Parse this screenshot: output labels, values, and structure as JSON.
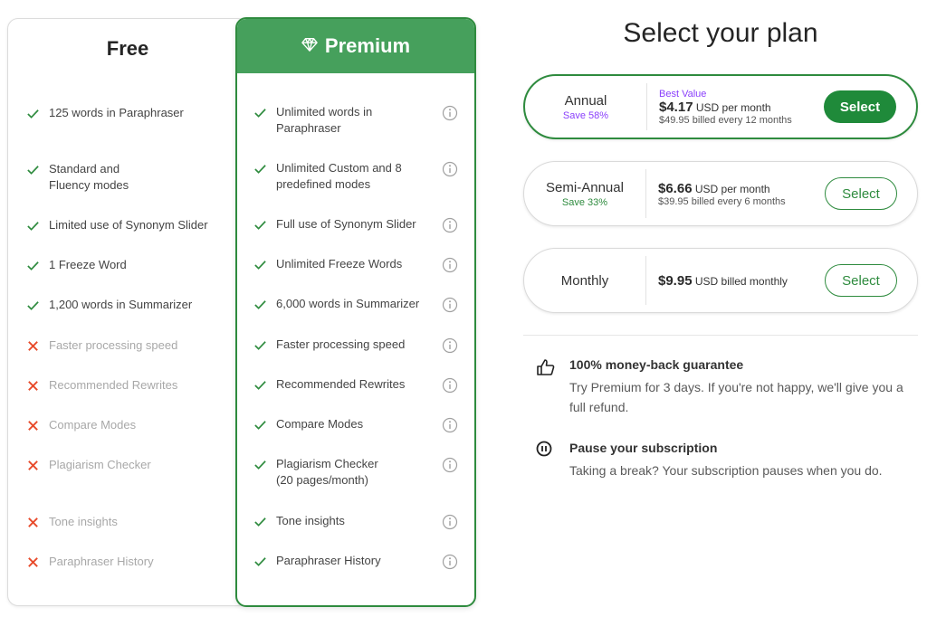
{
  "colors": {
    "brand_green": "#2e8b3e",
    "premium_header": "#46a05c",
    "check_green": "#2e8b3e",
    "cross_red": "#e84a2a",
    "accent_purple": "#8a3ffc",
    "save_green": "#2e8b3e"
  },
  "free_plan": {
    "title": "Free",
    "features": [
      {
        "text": "125 words in Paraphraser",
        "included": true
      },
      {
        "text": "Standard and Fluency modes",
        "included": true
      },
      {
        "text": "Limited use of Synonym Slider",
        "included": true
      },
      {
        "text": "1 Freeze Word",
        "included": true
      },
      {
        "text": "1,200 words in Summarizer",
        "included": true
      },
      {
        "text": "Faster processing speed",
        "included": false
      },
      {
        "text": "Recommended Rewrites",
        "included": false
      },
      {
        "text": "Compare Modes",
        "included": false
      },
      {
        "text": "Plagiarism Checker",
        "included": false
      },
      {
        "text": "Tone insights",
        "included": false
      },
      {
        "text": "Paraphraser History",
        "included": false
      }
    ]
  },
  "premium_plan": {
    "title": "Premium",
    "icon": "diamond-icon",
    "features": [
      {
        "text": "Unlimited words in Paraphraser",
        "included": true
      },
      {
        "text": "Unlimited Custom and 8 predefined modes",
        "included": true
      },
      {
        "text": "Full use of Synonym Slider",
        "included": true
      },
      {
        "text": "Unlimited Freeze Words",
        "included": true
      },
      {
        "text": "6,000 words in Summarizer",
        "included": true
      },
      {
        "text": "Faster processing speed",
        "included": true
      },
      {
        "text": "Recommended Rewrites",
        "included": true
      },
      {
        "text": "Compare Modes",
        "included": true
      },
      {
        "text": "Plagiarism Checker (20 pages/month)",
        "included": true
      },
      {
        "text": "Tone insights",
        "included": true
      },
      {
        "text": "Paraphraser History",
        "included": true
      }
    ]
  },
  "plan_selector": {
    "title": "Select your plan",
    "options": [
      {
        "name": "Annual",
        "save": "Save 58%",
        "badge": "Best Value",
        "price": "$4.17",
        "price_suffix": "USD per month",
        "billing": "$49.95 billed every 12 months",
        "button": "Select",
        "selected": true
      },
      {
        "name": "Semi-Annual",
        "save": "Save 33%",
        "badge": "",
        "price": "$6.66",
        "price_suffix": "USD per month",
        "billing": "$39.95 billed every 6 months",
        "button": "Select",
        "selected": false
      },
      {
        "name": "Monthly",
        "save": "",
        "badge": "",
        "price": "$9.95",
        "price_suffix": "USD billed monthly",
        "billing": "",
        "button": "Select",
        "selected": false
      }
    ]
  },
  "benefits": [
    {
      "icon": "thumbs-up-icon",
      "title": "100% money-back guarantee",
      "description": "Try Premium for 3 days. If you're not happy, we'll give you a full refund."
    },
    {
      "icon": "pause-circle-icon",
      "title": "Pause your subscription",
      "description": "Taking a break? Your subscription pauses when you do."
    }
  ]
}
